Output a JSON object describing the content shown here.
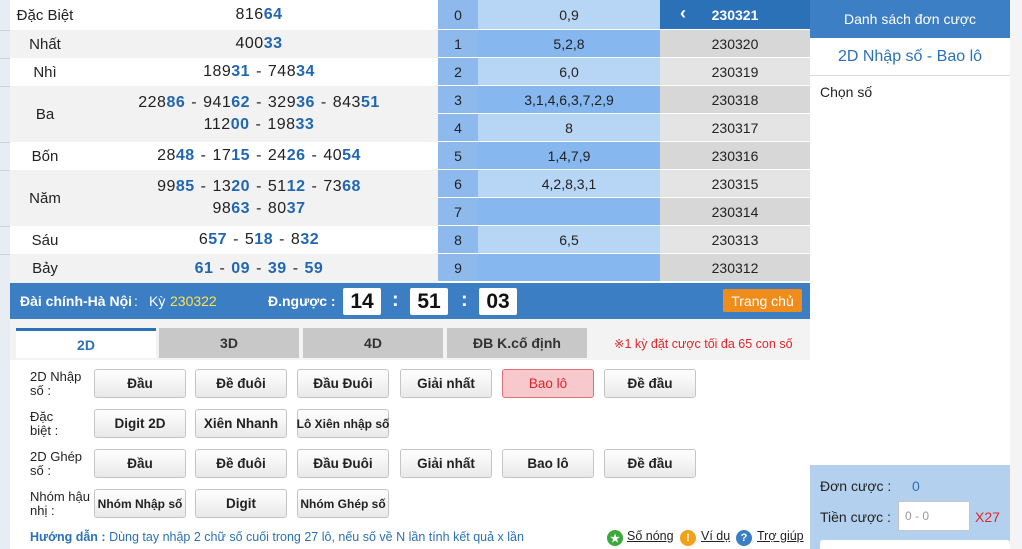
{
  "results": [
    {
      "name": "Đặc Biệt",
      "lines": [
        [
          {
            "h": "816",
            "t": "64"
          }
        ]
      ]
    },
    {
      "name": "Nhất",
      "lines": [
        [
          {
            "h": "400",
            "t": "33"
          }
        ]
      ]
    },
    {
      "name": "Nhì",
      "lines": [
        [
          {
            "h": "189",
            "t": "31"
          },
          {
            "h": "748",
            "t": "34"
          }
        ]
      ]
    },
    {
      "name": "Ba",
      "lines": [
        [
          {
            "h": "228",
            "t": "86"
          },
          {
            "h": "941",
            "t": "62"
          },
          {
            "h": "329",
            "t": "36"
          },
          {
            "h": "843",
            "t": "51"
          }
        ],
        [
          {
            "h": "112",
            "t": "00"
          },
          {
            "h": "198",
            "t": "33"
          }
        ]
      ]
    },
    {
      "name": "Bốn",
      "lines": [
        [
          {
            "h": "28",
            "t": "48"
          },
          {
            "h": "17",
            "t": "15"
          },
          {
            "h": "24",
            "t": "26"
          },
          {
            "h": "40",
            "t": "54"
          }
        ]
      ]
    },
    {
      "name": "Năm",
      "lines": [
        [
          {
            "h": "99",
            "t": "85"
          },
          {
            "h": "13",
            "t": "20"
          },
          {
            "h": "51",
            "t": "12"
          },
          {
            "h": "73",
            "t": "68"
          }
        ],
        [
          {
            "h": "98",
            "t": "63"
          },
          {
            "h": "80",
            "t": "37"
          }
        ]
      ]
    },
    {
      "name": "Sáu",
      "lines": [
        [
          {
            "h": "6",
            "t": "57"
          },
          {
            "h": "5",
            "t": "18"
          },
          {
            "h": "8",
            "t": "32"
          }
        ]
      ]
    },
    {
      "name": "Bảy",
      "lines": [
        [
          {
            "h": "",
            "t": "61"
          },
          {
            "h": "",
            "t": "09"
          },
          {
            "h": "",
            "t": "39"
          },
          {
            "h": "",
            "t": "59"
          }
        ]
      ]
    }
  ],
  "separator": "-",
  "heads": [
    {
      "index": "0",
      "value": "0,9"
    },
    {
      "index": "1",
      "value": "5,2,8"
    },
    {
      "index": "2",
      "value": "6,0"
    },
    {
      "index": "3",
      "value": "3,1,4,6,3,7,2,9"
    },
    {
      "index": "4",
      "value": "8"
    },
    {
      "index": "5",
      "value": "1,4,7,9"
    },
    {
      "index": "6",
      "value": "4,2,8,3,1"
    },
    {
      "index": "7",
      "value": ""
    },
    {
      "index": "8",
      "value": "6,5"
    },
    {
      "index": "9",
      "value": ""
    }
  ],
  "periods": [
    "230321",
    "230320",
    "230319",
    "230318",
    "230317",
    "230316",
    "230315",
    "230314",
    "230313",
    "230312"
  ],
  "periods_chevron": "‹",
  "status": {
    "region": "Đài chính-Hà Nội",
    "separator": ":",
    "ky_label": "Kỳ",
    "ky_value": "230322",
    "countdown_label": "Đ.ngược :",
    "hours": "14",
    "minutes": "51",
    "seconds": "03",
    "colon": ":",
    "home_button": "Trang chủ"
  },
  "tabs": [
    "2D",
    "3D",
    "4D",
    "ĐB K.cố định"
  ],
  "tab_note": "※1 kỳ đặt cược tối đa 65 con số",
  "bet_groups": {
    "nhap_so": {
      "label_line1": "2D Nhập",
      "label_line2": "số :",
      "buttons": [
        "Đầu",
        "Đề đuôi",
        "Đầu Đuôi",
        "Giải nhất",
        "Bao lô",
        "Đề đầu"
      ]
    },
    "dac_biet": {
      "label_line1": "Đặc",
      "label_line2": "biệt :",
      "buttons": [
        "Digit 2D",
        "Xiên Nhanh",
        "Lô Xiên nhập số"
      ]
    },
    "ghep_so": {
      "label_line1": "2D Ghép",
      "label_line2": "số :",
      "buttons": [
        "Đầu",
        "Đề đuôi",
        "Đầu Đuôi",
        "Giải nhất",
        "Bao lô",
        "Đề đầu"
      ]
    },
    "nhom_hau": {
      "label_line1": "Nhóm hậu",
      "label_line2": "nhị :",
      "buttons": [
        "Nhóm Nhập số",
        "Digit",
        "Nhóm Ghép số"
      ]
    }
  },
  "guide": {
    "label": "Hướng dẫn :",
    "text": "Dùng tay nhập 2 chữ số cuối trong 27 lô, nếu số về N lần tính kết quả x lần",
    "links": [
      "Số nóng",
      "Ví dụ",
      "Trợ giúp"
    ]
  },
  "right_panel": {
    "title": "Danh sách đơn cược",
    "subtitle": "2D Nhập số - Bao lô",
    "choose_label": "Chọn số",
    "order_label": "Đơn cược :",
    "order_count": "0",
    "money_label": "Tiền cược :",
    "money_placeholder": "0 - 0",
    "multiplier": "X27"
  },
  "colors": {
    "accent_blue": "#3b7ec4",
    "tail_blue": "#2167b0",
    "home_orange": "#f08c1c",
    "active_bet_pink": "#f7c9cc",
    "note_red": "#e0262a"
  },
  "icons": {
    "hot": "star-icon",
    "example": "exclamation-icon",
    "help": "question-icon"
  }
}
